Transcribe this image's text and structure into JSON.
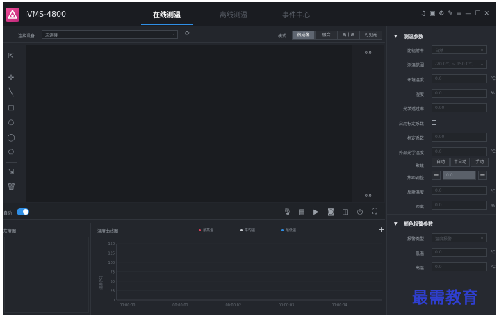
{
  "app": {
    "title": "iVMS-4800"
  },
  "nav": {
    "tabs": [
      {
        "label": "在线测温",
        "active": true
      },
      {
        "label": "离线测温",
        "active": false
      },
      {
        "label": "事件中心",
        "active": false
      }
    ]
  },
  "window_icons": [
    "bell-icon",
    "screenshot-icon",
    "gear-icon",
    "brush-icon",
    "menu-icon",
    "minimize-icon",
    "maximize-icon",
    "close-icon"
  ],
  "toolbar": {
    "device_label": "连接设备",
    "device_value": "未连接",
    "mode_label": "模式",
    "modes": [
      {
        "label": "热成像",
        "active": true
      },
      {
        "label": "融合",
        "active": false
      },
      {
        "label": "画中画",
        "active": false
      },
      {
        "label": "可见光",
        "active": false
      }
    ]
  },
  "tools": [
    "cursor-icon",
    "point-icon",
    "line-icon",
    "rectangle-icon",
    "circle-icon",
    "ellipse-icon",
    "polygon-icon",
    "select-icon",
    "delete-icon"
  ],
  "temp_scale": {
    "top": "0.0",
    "bottom": "0.0"
  },
  "bottombar": {
    "auto_label": "自动"
  },
  "gray_panel": {
    "title": "灰度图"
  },
  "curve_panel": {
    "title": "温度曲线图",
    "add_label": "+",
    "legend": [
      {
        "name": "最高温",
        "color": "#e0405a"
      },
      {
        "name": "平均温",
        "color": "#c8ccd2"
      },
      {
        "name": "最低温",
        "color": "#2f8fe6"
      }
    ],
    "y_axis_label": "温度(℃)"
  },
  "chart_data": {
    "type": "line",
    "title": "温度曲线图",
    "ylabel": "温度(℃)",
    "ylim": [
      0,
      150
    ],
    "yticks": [
      "150",
      "125",
      "100",
      "75",
      "50",
      "25",
      "0"
    ],
    "xticks": [
      "00:00:00",
      "00:00:01",
      "00:00:02",
      "00:00:03",
      "00:00:04"
    ],
    "series": [
      {
        "name": "最高温",
        "values": []
      },
      {
        "name": "平均温",
        "values": []
      },
      {
        "name": "最低温",
        "values": []
      }
    ]
  },
  "right_panel": {
    "measure_section": {
      "title": "测温参数",
      "emissivity_label": "比辐射率",
      "emissivity_value": "自然",
      "range_label": "测温范围",
      "range_value": "-20.0℃ ~ 150.0℃",
      "ambient_label": "环境温度",
      "ambient_value": "0.0",
      "ambient_unit": "℃",
      "humidity_label": "湿度",
      "humidity_value": "0.0",
      "humidity_unit": "%",
      "transmit_label": "光学透过率",
      "transmit_value": "0.00",
      "calib_enable_label": "启用标定系数",
      "calib_label": "标定系数",
      "calib_value": "0.00",
      "ext_transmit_label": "外部光学温度",
      "ext_transmit_value": "0.0",
      "ext_transmit_unit": "℃",
      "focus_label": "聚焦",
      "focus_buttons": [
        "自动",
        "半自动",
        "手动"
      ],
      "focus_adjust_label": "焦距调整",
      "focus_adjust_value": "0.0",
      "reflect_label": "反射温度",
      "reflect_value": "0.0",
      "reflect_unit": "℃",
      "distance_label": "距离",
      "distance_value": "0.0",
      "distance_unit": "m"
    },
    "alarm_section": {
      "title": "颜色报警参数",
      "alarm_type_label": "报警类型",
      "alarm_type_value": "温度报警",
      "low_label": "低温",
      "low_value": "0.0",
      "low_unit": "℃",
      "high_label": "高温",
      "high_value": "0.0",
      "high_unit": "℃"
    }
  },
  "watermark": "最需教育"
}
